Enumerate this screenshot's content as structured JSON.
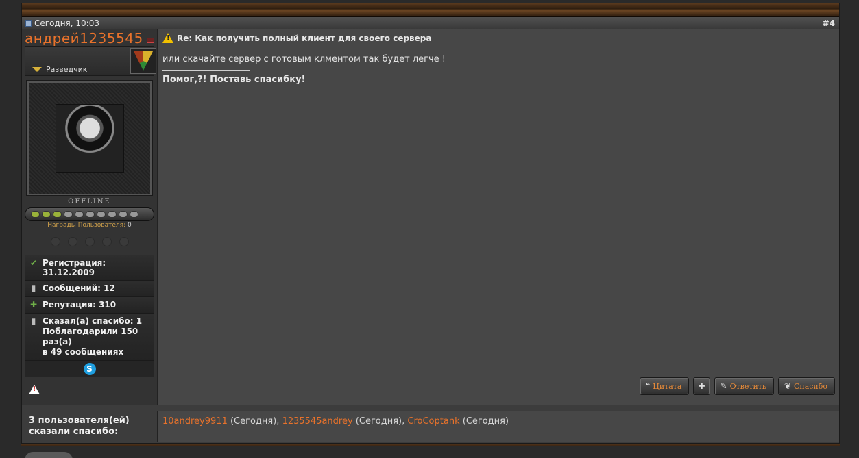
{
  "post": {
    "date": "Сегодня, 10:03",
    "number": "#4",
    "title": "Re: Как получить полный клиент для своего сервера",
    "message": "или скачайте сервер с готовым клментом так будет легче !",
    "signature": "Помог,?! Поставь спасибку!"
  },
  "user": {
    "name": "андрей1235545",
    "rank": "Разведчик",
    "status": "OFFLINE",
    "awards_label": "Награды Пользователя:",
    "awards_count": "0",
    "stats": {
      "registration": "Регистрация: 31.12.2009",
      "messages": "Сообщений: 12",
      "reputation": "Репутация: 310",
      "thanks_line1": "Сказал(а) спасибо: 1",
      "thanks_line2": "Поблагодарили 150 раз(а)",
      "thanks_line3": "в 49 сообщениях"
    }
  },
  "actions": {
    "quote": "Цитата",
    "reply": "Ответить",
    "thanks": "Спасибо"
  },
  "thanks_block": {
    "label_line1": "3 пользователя(ей)",
    "label_line2": "сказали спасибо:",
    "users": [
      {
        "name": "10andrey9911",
        "when": " (Сегодня), "
      },
      {
        "name": "1235545andrey",
        "when": " (Сегодня), "
      },
      {
        "name": "CroCoptank",
        "when": " (Сегодня)"
      }
    ]
  },
  "icons": {
    "accent": "#e8722b"
  }
}
